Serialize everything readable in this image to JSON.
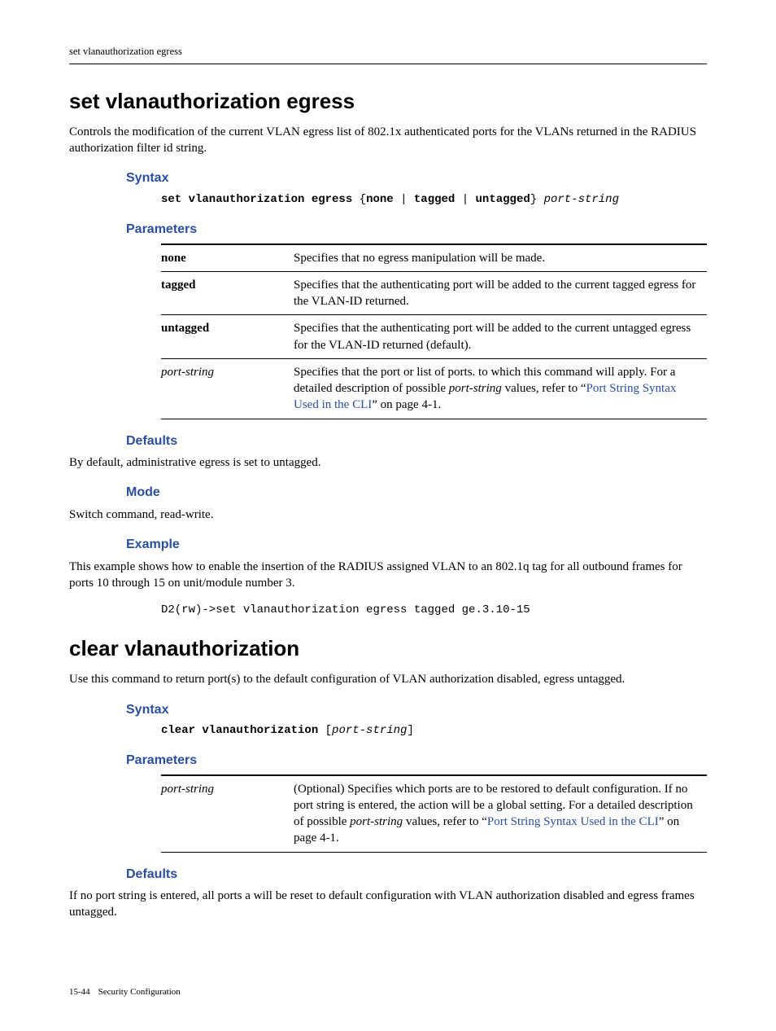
{
  "running_head": "set vlanauthorization egress",
  "cmd1": {
    "title": "set vlanauthorization egress",
    "intro": "Controls the modification of the current VLAN egress list of 802.1x authenticated ports for the VLANs returned in the RADIUS authorization filter id string.",
    "syntax_label": "Syntax",
    "syntax_cmd": "set vlanauthorization egress",
    "syntax_opt1": "none",
    "syntax_opt2": "tagged",
    "syntax_opt3": "untagged",
    "syntax_arg": "port-string",
    "params_label": "Parameters",
    "params": {
      "r1_name": "none",
      "r1_desc": "Specifies that no egress manipulation will be made.",
      "r2_name": "tagged",
      "r2_desc": "Specifies that the authenticating port will be added to the current tagged egress for the VLAN-ID returned.",
      "r3_name": "untagged",
      "r3_desc": "Specifies that the authenticating port will be added to the current untagged egress for the VLAN-ID returned (default).",
      "r4_name": "port-string",
      "r4_desc_a": "Specifies that the port or list of ports. to which this command will apply. For a detailed description of possible ",
      "r4_desc_b": "port-string",
      "r4_desc_c": " values, refer to “",
      "r4_link": "Port String Syntax Used in the CLI",
      "r4_desc_d": "” on page 4-1."
    },
    "defaults_label": "Defaults",
    "defaults_text": "By default, administrative egress is set to untagged.",
    "mode_label": "Mode",
    "mode_text": "Switch command, read-write.",
    "example_label": "Example",
    "example_text": "This example shows how to enable the insertion of the RADIUS assigned VLAN to an 802.1q tag for all outbound frames for ports 10 through 15 on unit/module number 3.",
    "example_cli": "D2(rw)->set vlanauthorization egress tagged ge.3.10-15"
  },
  "cmd2": {
    "title": "clear vlanauthorization",
    "intro": "Use this command to return port(s) to the default configuration of VLAN authorization disabled, egress untagged.",
    "syntax_label": "Syntax",
    "syntax_cmd": "clear vlanauthorization",
    "syntax_arg": "port-string",
    "params_label": "Parameters",
    "params": {
      "r1_name": "port-string",
      "r1_desc_a": "(Optional) Specifies which ports are to be restored to default configuration. If no port string is entered, the action will be a global setting. For a detailed description of possible ",
      "r1_desc_b": "port-string",
      "r1_desc_c": " values, refer to “",
      "r1_link": "Port String Syntax Used in the CLI",
      "r1_desc_d": "” on page 4-1."
    },
    "defaults_label": "Defaults",
    "defaults_text": "If no port string is entered, all ports a will be reset to default configuration with VLAN authorization disabled and egress frames untagged."
  },
  "footer": {
    "pageno": "15-44",
    "label": "Security Configuration"
  }
}
